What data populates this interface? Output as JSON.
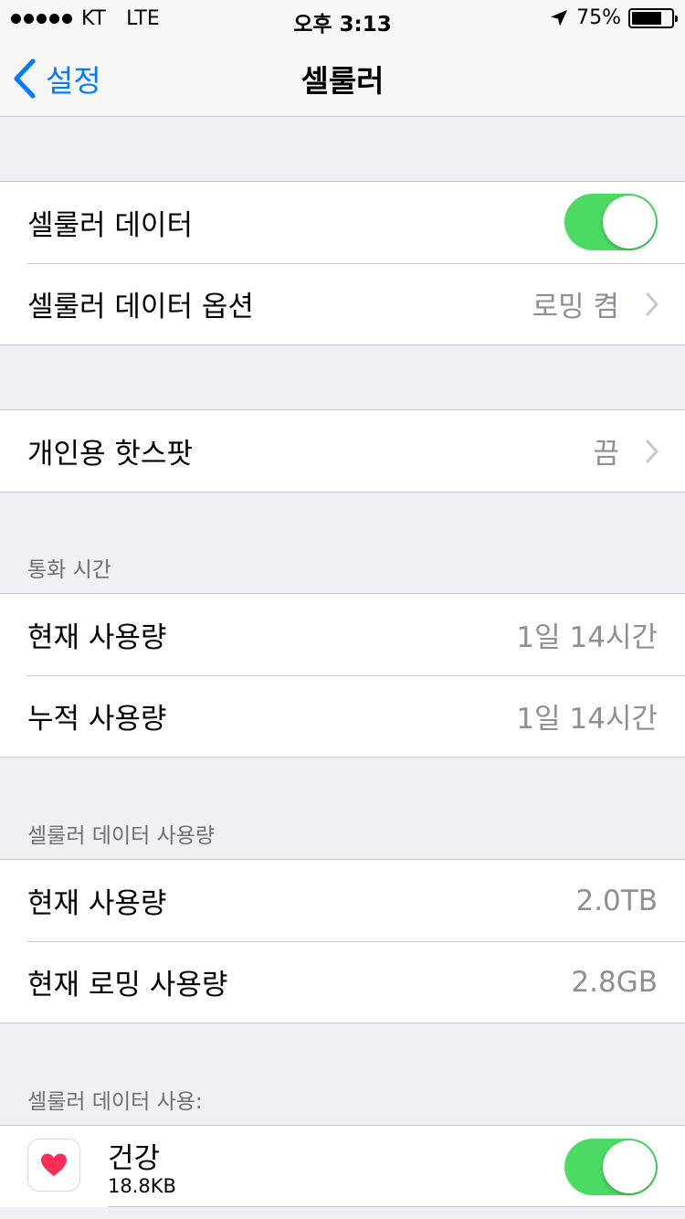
{
  "status_bar": {
    "carrier": "KT",
    "network": "LTE",
    "time": "오후 3:13",
    "battery_percent": "75%",
    "battery_level": 0.75
  },
  "nav": {
    "back_label": "설정",
    "title": "셀룰러"
  },
  "group1": {
    "cellular_data_label": "셀룰러 데이터",
    "cellular_data_on": true,
    "options_label": "셀룰러 데이터 옵션",
    "options_value": "로밍 켬"
  },
  "group2": {
    "hotspot_label": "개인용 핫스팟",
    "hotspot_value": "끔"
  },
  "call_time": {
    "header": "통화 시간",
    "current_label": "현재 사용량",
    "current_value": "1일 14시간",
    "total_label": "누적 사용량",
    "total_value": "1일 14시간"
  },
  "data_usage": {
    "header": "셀룰러 데이터 사용량",
    "current_label": "현재 사용량",
    "current_value": "2.0TB",
    "roaming_label": "현재 로밍 사용량",
    "roaming_value": "2.8GB"
  },
  "apps": {
    "header": "셀룰러 데이터 사용:",
    "items": [
      {
        "name": "건강",
        "size": "18.8KB",
        "icon": "heart-icon",
        "enabled": true
      }
    ]
  },
  "colors": {
    "accent": "#007aff",
    "switch_on": "#4cd964",
    "heart": "#ff2d55"
  }
}
